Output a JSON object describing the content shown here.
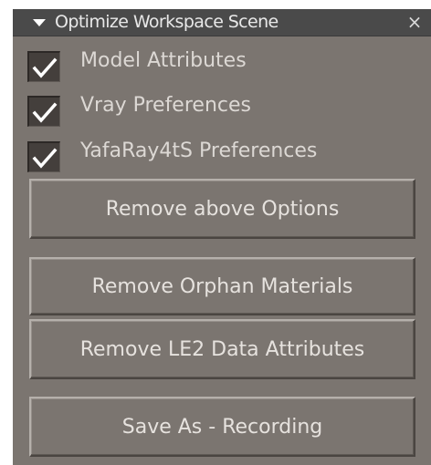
{
  "panel": {
    "title": "Optimize Workspace Scene",
    "collapse_icon": "triangle-down-icon",
    "close_glyph": "×"
  },
  "options": [
    {
      "label": "Model Attributes",
      "checked": true
    },
    {
      "label": "Vray Preferences",
      "checked": true
    },
    {
      "label": "YafaRay4tS Preferences",
      "checked": true
    }
  ],
  "buttons": {
    "remove_options": "Remove above Options",
    "remove_orphan": "Remove Orphan Materials",
    "remove_le2": "Remove LE2 Data Attributes",
    "save_as": "Save As - Recording"
  },
  "colors": {
    "panel_bg": "#7b7570",
    "titlebar_bg": "#4a4a4a",
    "checkbox_bg": "#443f3c",
    "text": "#e6e2de"
  }
}
